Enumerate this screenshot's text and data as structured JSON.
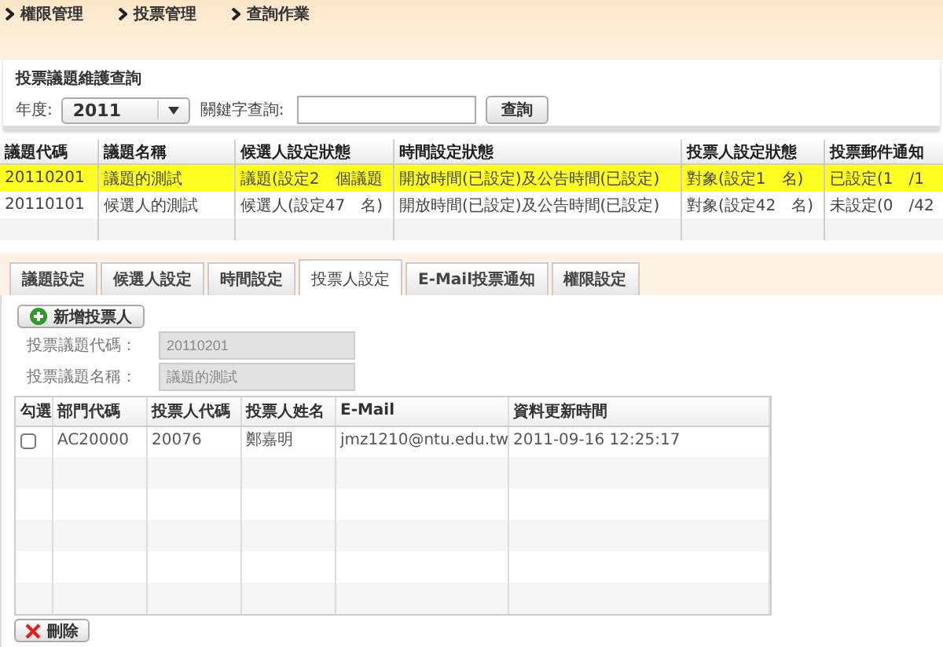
{
  "breadcrumb": [
    {
      "label": "權限管理"
    },
    {
      "label": "投票管理"
    },
    {
      "label": "查詢作業"
    }
  ],
  "query_panel": {
    "title": "投票議題維護查詢",
    "year_label": "年度:",
    "year_value": "2011",
    "keyword_label": "關鍵字查詢:",
    "search_button": "查詢"
  },
  "topics_table": {
    "columns": [
      "議題代碼",
      "議題名稱",
      "候選人設定狀態",
      "時間設定狀態",
      "投票人設定狀態",
      "投票郵件通知"
    ],
    "rows": [
      {
        "selected": true,
        "cells": [
          "20110201",
          "議題的測試",
          "議題(設定2　個議題",
          "開放時間(已設定)及公告時間(已設定)",
          "對象(設定1　名)",
          "已設定(1　/1"
        ]
      },
      {
        "selected": false,
        "cells": [
          "20110101",
          "候選人的測試",
          "候選人(設定47　名)",
          "開放時間(已設定)及公告時間(已設定)",
          "對象(設定42　名)",
          "未設定(0　/42"
        ]
      }
    ]
  },
  "tabs": [
    {
      "label": "議題設定",
      "selected": false
    },
    {
      "label": "候選人設定",
      "selected": false
    },
    {
      "label": "時間設定",
      "selected": false
    },
    {
      "label": "投票人設定",
      "selected": true
    },
    {
      "label": "E-Mail投票通知",
      "selected": false
    },
    {
      "label": "權限設定",
      "selected": false
    }
  ],
  "add_button": "新增投票人",
  "fields": [
    {
      "label": "投票議題代碼：",
      "value": "20110201",
      "disabled": true
    },
    {
      "label": "投票議題名稱：",
      "value": "議題的測試",
      "disabled": true
    }
  ],
  "voters_table": {
    "columns": [
      "勾選",
      "部門代碼",
      "投票人代碼",
      "投票人姓名",
      "E-Mail",
      "資料更新時間"
    ],
    "rows": [
      {
        "checked": false,
        "cells": [
          "",
          "AC20000",
          "20076",
          "鄭嘉明",
          "jmz1210@ntu.edu.tw",
          "2011-09-16 12:25:17"
        ]
      }
    ]
  },
  "delete_button": "刪除"
}
